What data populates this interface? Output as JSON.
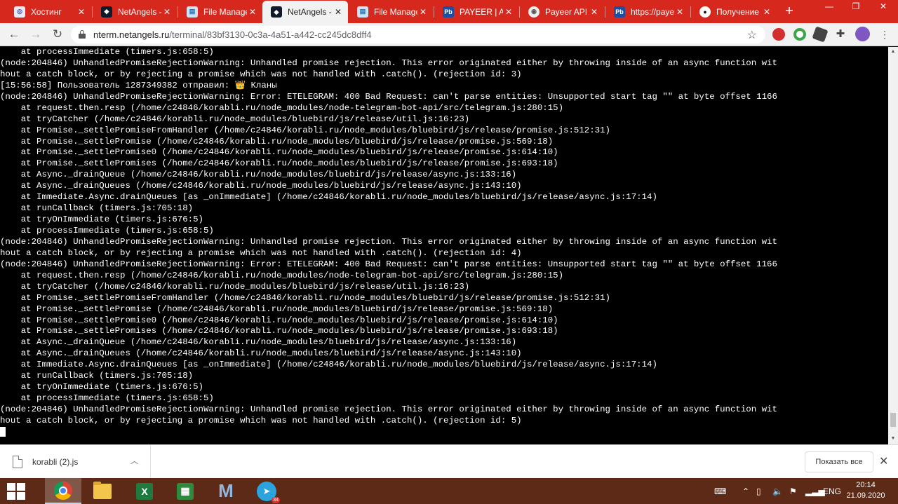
{
  "browser": {
    "tabs": [
      {
        "label": "Хостинг",
        "icon": "hosting-icon",
        "active": false
      },
      {
        "label": "NetAngels -",
        "icon": "netangels-icon",
        "active": false
      },
      {
        "label": "File Manage",
        "icon": "file-manager-icon",
        "active": false
      },
      {
        "label": "NetAngels -",
        "icon": "netangels-icon",
        "active": true
      },
      {
        "label": "File Manage",
        "icon": "file-manager-icon",
        "active": false
      },
      {
        "label": "PAYEER | AP",
        "icon": "payeer-icon",
        "active": false
      },
      {
        "label": "Payeer API (",
        "icon": "globe-icon",
        "active": false
      },
      {
        "label": "https://paye",
        "icon": "payeer-icon",
        "active": false
      },
      {
        "label": "Получение",
        "icon": "github-icon",
        "active": false
      }
    ],
    "url_host": "nterm.netangels.ru",
    "url_path": "/terminal/83bf3130-0c3a-4a51-a442-cc245dc8dff4",
    "accent_color": "#d7281e"
  },
  "terminal": {
    "lines": [
      "    at processImmediate (timers.js:658:5)",
      "(node:204846) UnhandledPromiseRejectionWarning: Unhandled promise rejection. This error originated either by throwing inside of an async function wit",
      "hout a catch block, or by rejecting a promise which was not handled with .catch(). (rejection id: 3)",
      "[15:56:58] Пользователь 1287349382 отправил: 👑 Кланы",
      "(node:204846) UnhandledPromiseRejectionWarning: Error: ETELEGRAM: 400 Bad Request: can't parse entities: Unsupported start tag \"\" at byte offset 1166",
      "    at request.then.resp (/home/c24846/korabli.ru/node_modules/node-telegram-bot-api/src/telegram.js:280:15)",
      "    at tryCatcher (/home/c24846/korabli.ru/node_modules/bluebird/js/release/util.js:16:23)",
      "    at Promise._settlePromiseFromHandler (/home/c24846/korabli.ru/node_modules/bluebird/js/release/promise.js:512:31)",
      "    at Promise._settlePromise (/home/c24846/korabli.ru/node_modules/bluebird/js/release/promise.js:569:18)",
      "    at Promise._settlePromise0 (/home/c24846/korabli.ru/node_modules/bluebird/js/release/promise.js:614:10)",
      "    at Promise._settlePromises (/home/c24846/korabli.ru/node_modules/bluebird/js/release/promise.js:693:18)",
      "    at Async._drainQueue (/home/c24846/korabli.ru/node_modules/bluebird/js/release/async.js:133:16)",
      "    at Async._drainQueues (/home/c24846/korabli.ru/node_modules/bluebird/js/release/async.js:143:10)",
      "    at Immediate.Async.drainQueues [as _onImmediate] (/home/c24846/korabli.ru/node_modules/bluebird/js/release/async.js:17:14)",
      "    at runCallback (timers.js:705:18)",
      "    at tryOnImmediate (timers.js:676:5)",
      "    at processImmediate (timers.js:658:5)",
      "(node:204846) UnhandledPromiseRejectionWarning: Unhandled promise rejection. This error originated either by throwing inside of an async function wit",
      "hout a catch block, or by rejecting a promise which was not handled with .catch(). (rejection id: 4)",
      "(node:204846) UnhandledPromiseRejectionWarning: Error: ETELEGRAM: 400 Bad Request: can't parse entities: Unsupported start tag \"\" at byte offset 1166",
      "    at request.then.resp (/home/c24846/korabli.ru/node_modules/node-telegram-bot-api/src/telegram.js:280:15)",
      "    at tryCatcher (/home/c24846/korabli.ru/node_modules/bluebird/js/release/util.js:16:23)",
      "    at Promise._settlePromiseFromHandler (/home/c24846/korabli.ru/node_modules/bluebird/js/release/promise.js:512:31)",
      "    at Promise._settlePromise (/home/c24846/korabli.ru/node_modules/bluebird/js/release/promise.js:569:18)",
      "    at Promise._settlePromise0 (/home/c24846/korabli.ru/node_modules/bluebird/js/release/promise.js:614:10)",
      "    at Promise._settlePromises (/home/c24846/korabli.ru/node_modules/bluebird/js/release/promise.js:693:18)",
      "    at Async._drainQueue (/home/c24846/korabli.ru/node_modules/bluebird/js/release/async.js:133:16)",
      "    at Async._drainQueues (/home/c24846/korabli.ru/node_modules/bluebird/js/release/async.js:143:10)",
      "    at Immediate.Async.drainQueues [as _onImmediate] (/home/c24846/korabli.ru/node_modules/bluebird/js/release/async.js:17:14)",
      "    at runCallback (timers.js:705:18)",
      "    at tryOnImmediate (timers.js:676:5)",
      "    at processImmediate (timers.js:658:5)",
      "(node:204846) UnhandledPromiseRejectionWarning: Unhandled promise rejection. This error originated either by throwing inside of an async function wit",
      "hout a catch block, or by rejecting a promise which was not handled with .catch(). (rejection id: 5)"
    ]
  },
  "downloads": {
    "file_name": "korabli (2).js",
    "show_all_label": "Показать все"
  },
  "taskbar": {
    "apps": [
      "chrome-icon",
      "file-explorer-icon",
      "excel-icon",
      "calculator-icon",
      "m-app-icon",
      "telegram-icon"
    ],
    "telegram_badge": "34",
    "language": "ENG",
    "time": "20:14",
    "date": "21.09.2020",
    "color": "#5c2a16"
  }
}
